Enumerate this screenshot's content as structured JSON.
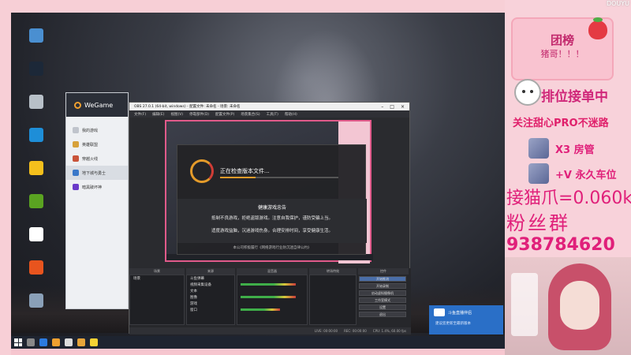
{
  "wegame": {
    "brand": "WeGame",
    "items": [
      "我的游戏",
      "英雄联盟",
      "穿越火线",
      "地下城与勇士",
      "暗黑破坏神"
    ]
  },
  "obs": {
    "title": "OBS 27.0.1 (64-bit, windows) - 配置文件: 未命名 - 场景: 未命名",
    "menu": [
      "文件(F)",
      "编辑(E)",
      "视图(V)",
      "停靠部件(D)",
      "配置文件(P)",
      "场景集合(S)",
      "工具(T)",
      "帮助(H)"
    ],
    "panels": [
      "场景",
      "来源",
      "混音器",
      "转场特效",
      "控件"
    ],
    "scene_name": "场景",
    "sources": [
      "斗鱼弹幕",
      "视频采集设备",
      "文本",
      "图像",
      "游戏",
      "窗口"
    ],
    "controls": [
      "开始推流",
      "开始录制",
      "启动虚拟摄像机",
      "工作室模式",
      "设置",
      "退出"
    ],
    "status": [
      "LIVE: 00:00:00",
      "REC: 00:00:00",
      "CPU: 1.4%, 60.00 fps"
    ]
  },
  "dialog": {
    "loading": "正在检查版本文件...",
    "notice_title": "健康游戏忠告",
    "notice_lines": [
      "抵制不良游戏，拒绝盗版游戏。注意自我保护，谨防受骗上当。",
      "适度游戏益脑，沉迷游戏伤身。合理安排时间，享受健康生活。"
    ],
    "footer": "本公司积极履行《网络游戏行业防沉迷自律公约》"
  },
  "toast": {
    "title": "斗鱼直播伴侣",
    "text": "建议您更新至最新版本"
  },
  "overlay": {
    "watermark": "DOUYU",
    "board_title": "团榜",
    "board_sub": "猪哥！！！",
    "line_top": "排位接单中",
    "line_sub": "关注甜心PRO不迷路",
    "rank1": "X3 房管",
    "rank2": "+V 永久车位",
    "big1": "接猫爪=0.060k",
    "big2": "粉丝群",
    "big3": "938784620"
  },
  "colors": {
    "accent_pink": "#e0207a",
    "obs_dark": "#2a2b2f",
    "toast_blue": "#2a6fc7"
  }
}
